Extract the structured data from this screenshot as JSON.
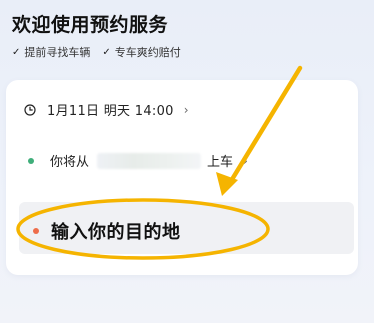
{
  "header": {
    "title": "欢迎使用预约服务",
    "features": [
      {
        "check_icon": "✓",
        "label": "提前寻找车辆"
      },
      {
        "check_icon": "✓",
        "label": "专车爽约赔付"
      }
    ]
  },
  "booking_card": {
    "time": {
      "icon": "clock-icon",
      "text": "1月11日 明天 14:00",
      "chevron": "›"
    },
    "pickup": {
      "prefix": "你将从",
      "suffix": "上车",
      "chevron": "›",
      "dot_color": "#3fae7a"
    },
    "destination": {
      "placeholder": "输入你的目的地",
      "dot_color": "#ee6d4a"
    }
  },
  "annotation": {
    "color": "#f5b400"
  }
}
